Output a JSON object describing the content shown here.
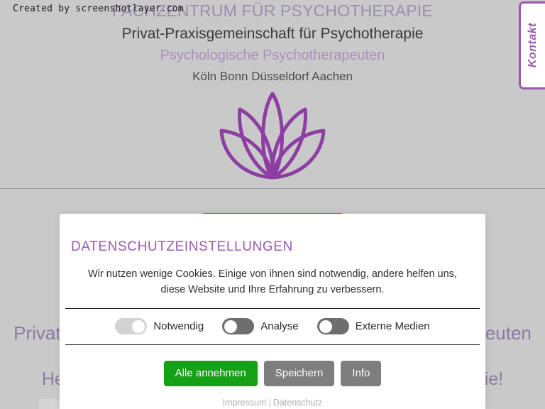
{
  "watermark": "Created by screenshotlayer.com",
  "header": {
    "line1": "FACHZENTRUM FÜR PSYCHOTHERAPIE",
    "line2": "Privat-Praxisgemeinschaft für Psychotherapie",
    "line3": "Psychologische Psychotherapeuten",
    "line4": "Köln Bonn Düsseldorf Aachen",
    "logo_icon": "lotus-flower-icon"
  },
  "side_tab": {
    "label": "Kontakt"
  },
  "background": {
    "headline": "Privat-Praxisgemeinschaft Psychologischer Psychotherapeuten",
    "subheadline": "Herzlich Willkommen in unserer Praxis für Psychotherapie!"
  },
  "dialog": {
    "title": "DATENSCHUTZEINSTELLUNGEN",
    "description": "Wir nutzen wenige Cookies. Einige von ihnen sind notwendig, andere helfen uns, diese Website und Ihre Erfahrung zu verbessern.",
    "toggles": [
      {
        "label": "Notwendig",
        "state": "on",
        "disabled": true
      },
      {
        "label": "Analyse",
        "state": "off",
        "disabled": false
      },
      {
        "label": "Externe Medien",
        "state": "off",
        "disabled": false
      }
    ],
    "buttons": {
      "accept_all": "Alle annehmen",
      "save": "Speichern",
      "info": "Info"
    },
    "links": {
      "imprint": "Impressum",
      "separator": "|",
      "privacy": "Datenschutz"
    }
  },
  "colors": {
    "page_background": "#c9c9c9",
    "brand_purple": "#9b59b6",
    "logo_purple": "#8e3ea3",
    "accent_green": "#16a016",
    "neutral_gray": "#7e7e7e"
  }
}
